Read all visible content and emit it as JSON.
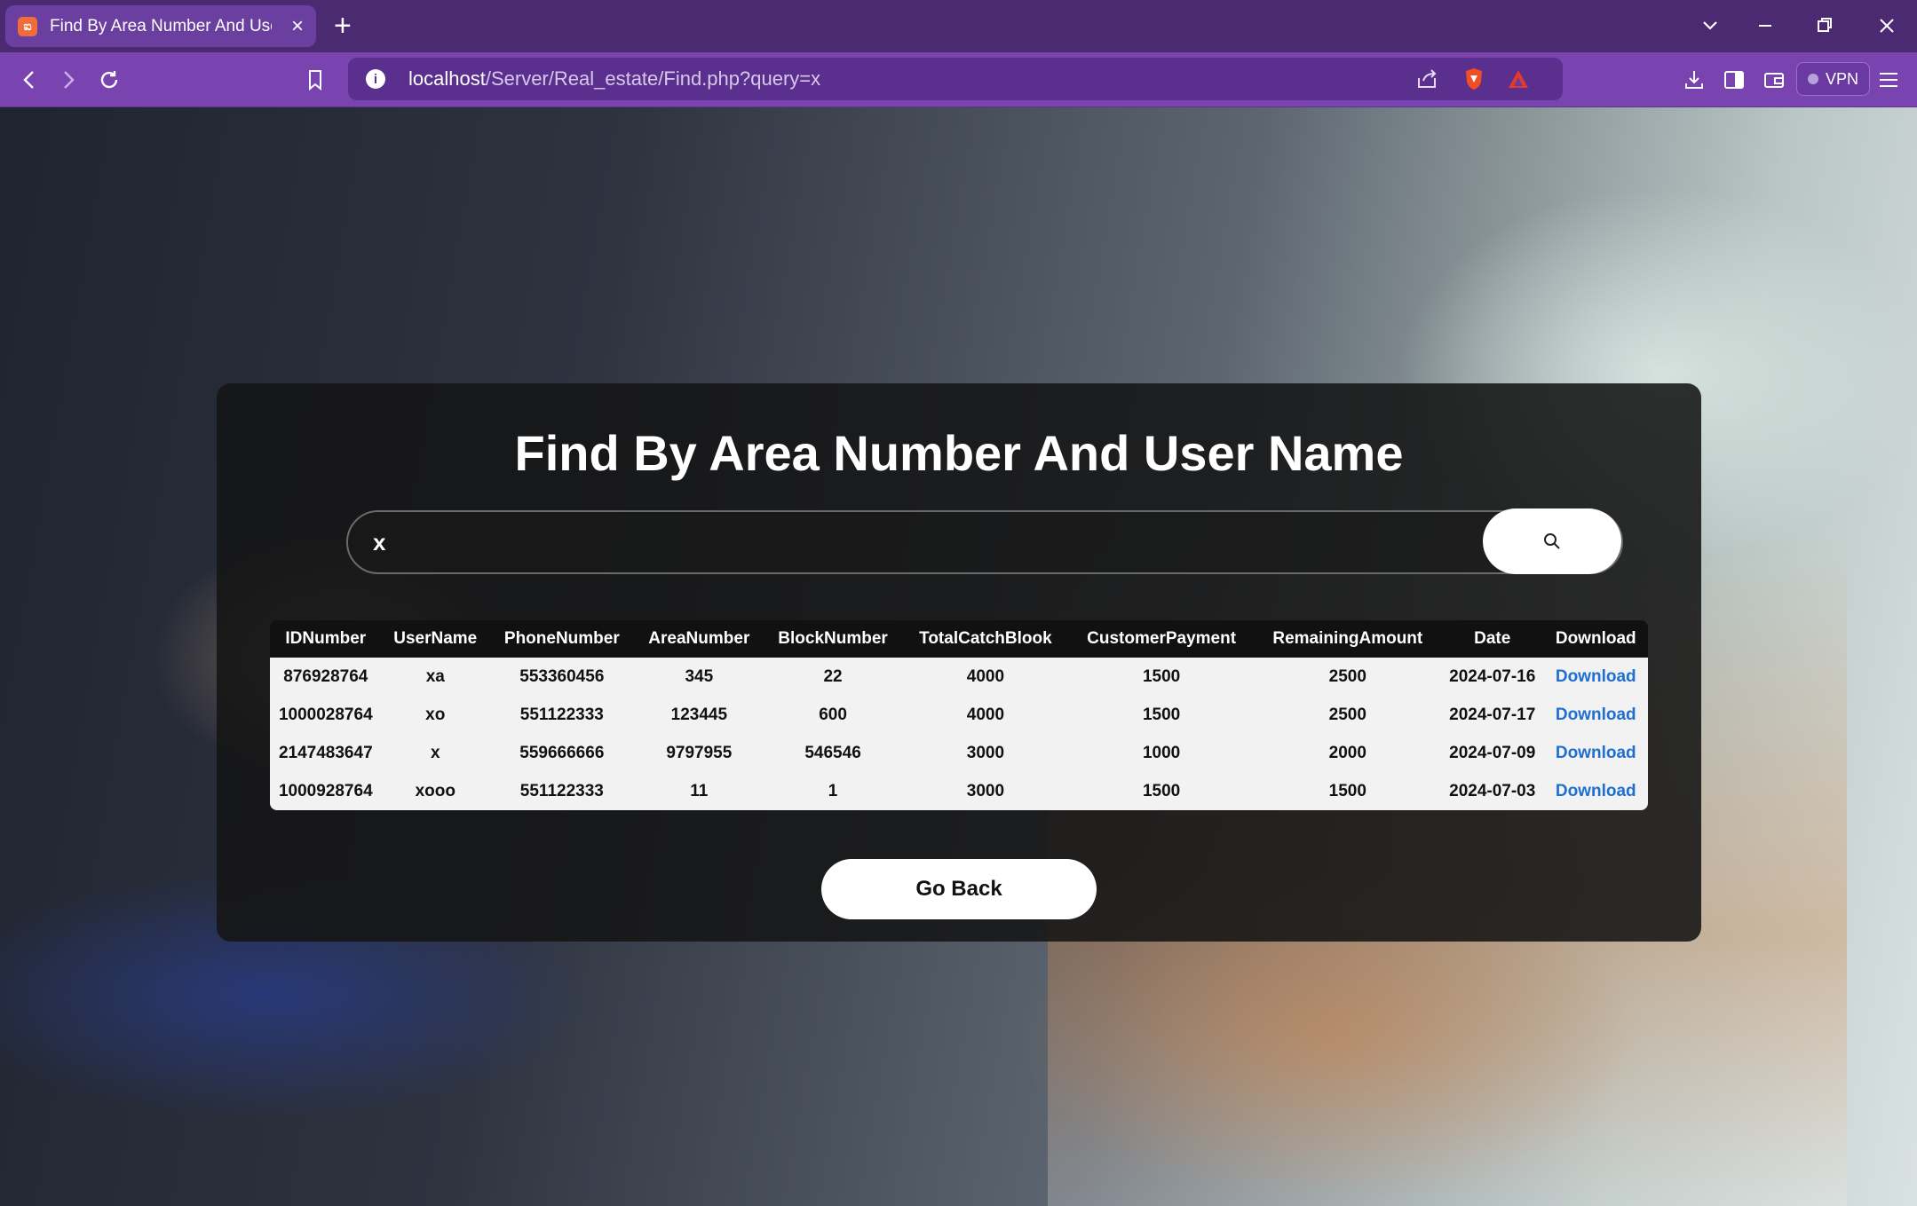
{
  "browser": {
    "tab_title": "Find By Area Number And User Name",
    "tab_icon": "xampp-icon",
    "url_host": "localhost",
    "url_path": "/Server/Real_estate/Find.php?query=x",
    "vpn_label": "VPN"
  },
  "page": {
    "title": "Find By Area Number And User Name",
    "search_value": "x",
    "go_back_label": "Go Back",
    "table": {
      "headers": [
        "IDNumber",
        "UserName",
        "PhoneNumber",
        "AreaNumber",
        "BlockNumber",
        "TotalCatchBlook",
        "CustomerPayment",
        "RemainingAmount",
        "Date",
        "Download"
      ],
      "rows": [
        [
          "876928764",
          "xa",
          "553360456",
          "345",
          "22",
          "4000",
          "1500",
          "2500",
          "2024-07-16",
          "Download"
        ],
        [
          "1000028764",
          "xo",
          "551122333",
          "123445",
          "600",
          "4000",
          "1500",
          "2500",
          "2024-07-17",
          "Download"
        ],
        [
          "2147483647",
          "x",
          "559666666",
          "9797955",
          "546546",
          "3000",
          "1000",
          "2000",
          "2024-07-09",
          "Download"
        ],
        [
          "1000928764",
          "xooo",
          "551122333",
          "11",
          "1",
          "3000",
          "1500",
          "1500",
          "2024-07-03",
          "Download"
        ]
      ]
    }
  },
  "colors": {
    "tabbar": "#4b2a72",
    "toolbar": "#7a44b0",
    "link": "#1e6fd0"
  }
}
